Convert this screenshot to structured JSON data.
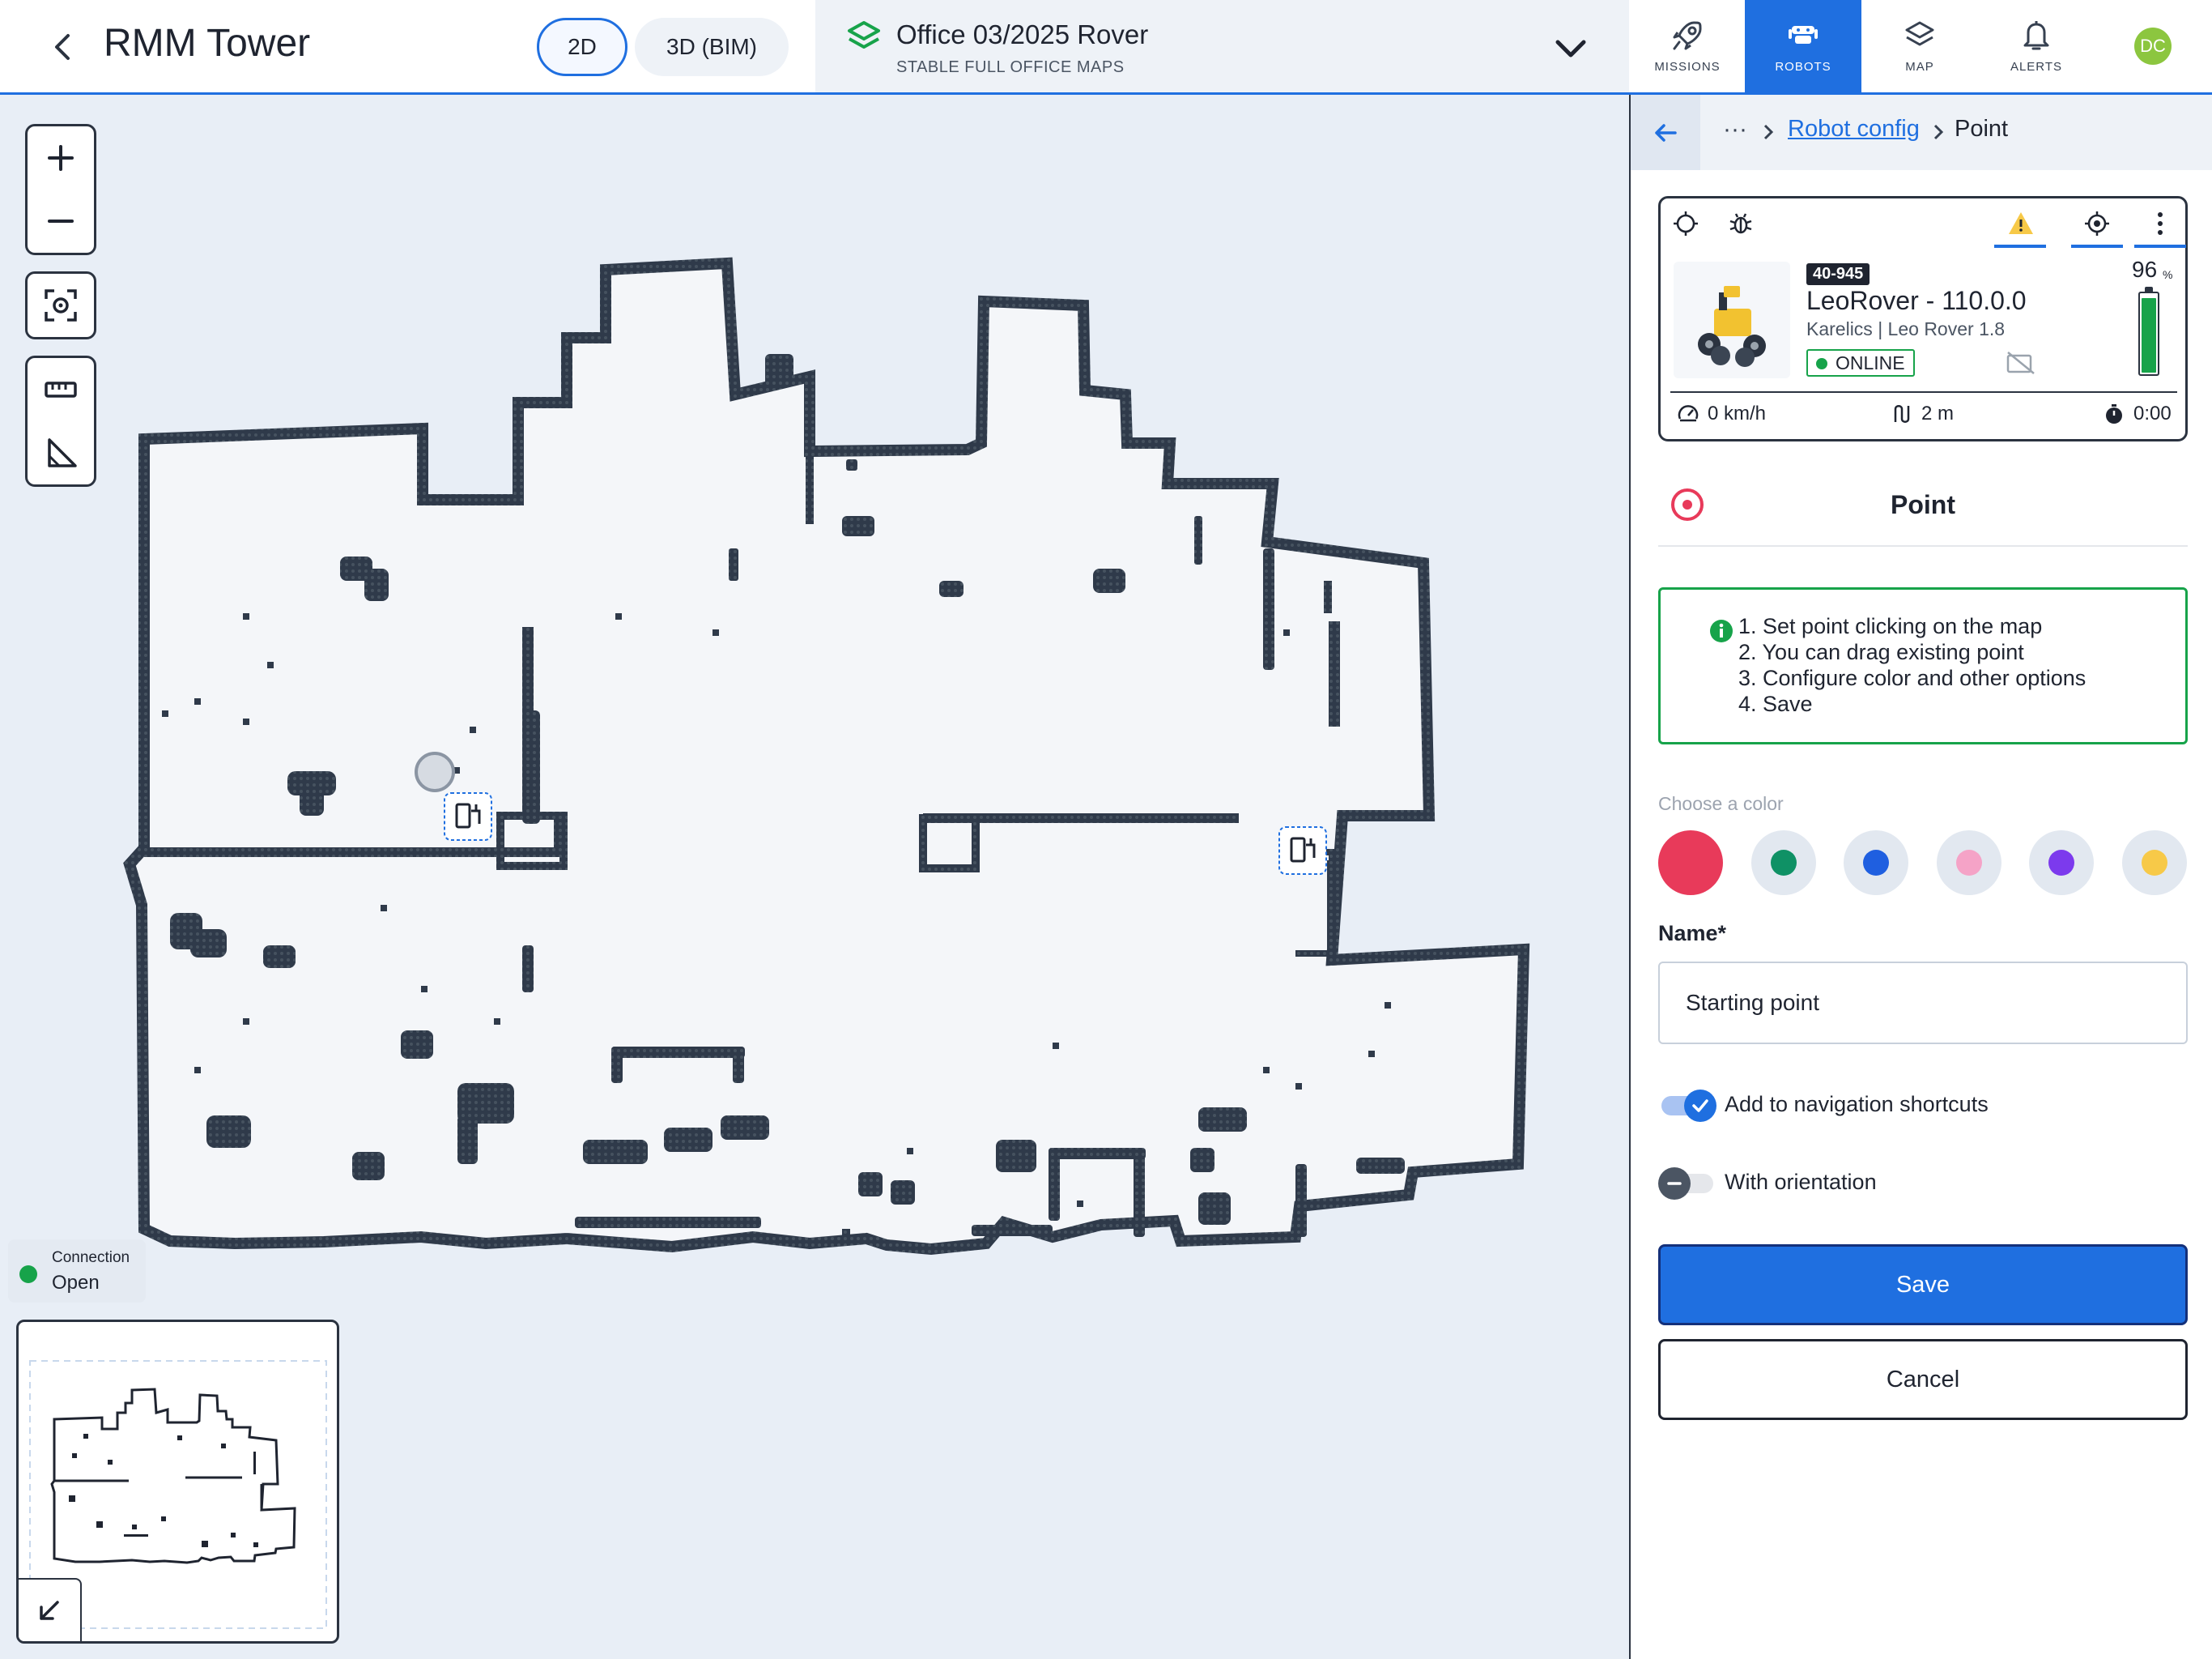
{
  "header": {
    "title": "RMM Tower",
    "view_2d": "2D",
    "view_3d": "3D (BIM)",
    "map_name": "Office 03/2025 Rover",
    "map_subtitle": "STABLE FULL OFFICE MAPS",
    "avatar_initials": "DC",
    "accent_color": "#1f6fe0",
    "nav": [
      {
        "label": "MISSIONS",
        "icon": "rocket-icon",
        "active": false
      },
      {
        "label": "ROBOTS",
        "icon": "robot-icon",
        "active": true
      },
      {
        "label": "MAP",
        "icon": "layers-icon",
        "active": false
      },
      {
        "label": "ALERTS",
        "icon": "bell-icon",
        "active": false
      }
    ]
  },
  "map": {
    "connection_label": "Connection",
    "connection_status": "Open",
    "connection_color": "#17a34a",
    "tools": [
      "zoom-in-icon",
      "zoom-out-icon",
      "fit-view-icon",
      "ruler-icon",
      "angle-icon"
    ]
  },
  "panel": {
    "breadcrumb": {
      "more": "···",
      "link": "Robot config",
      "current": "Point"
    },
    "robot": {
      "id": "40-945",
      "name": "LeoRover - 110.0.0",
      "model": "Karelics | Leo Rover 1.8",
      "status": "ONLINE",
      "battery": 96,
      "battery_unit": "%",
      "speed": "0 km/h",
      "distance": "2 m",
      "time": "0:00"
    },
    "point_title": "Point",
    "instructions": [
      "1. Set point clicking on the map",
      "2. You can drag existing point",
      "3. Configure color and other options",
      "4. Save"
    ],
    "color_label": "Choose a color",
    "colors": [
      "#e83a5a",
      "#0f9165",
      "#1f5fe0",
      "#f5a3c7",
      "#7c3aed",
      "#f7c948"
    ],
    "selected_color_index": 0,
    "name_label": "Name*",
    "name_value": "Starting point",
    "nav_shortcut_label": "Add to navigation shortcuts",
    "nav_shortcut_on": true,
    "orientation_label": "With orientation",
    "orientation_on": false,
    "save_label": "Save",
    "cancel_label": "Cancel"
  }
}
